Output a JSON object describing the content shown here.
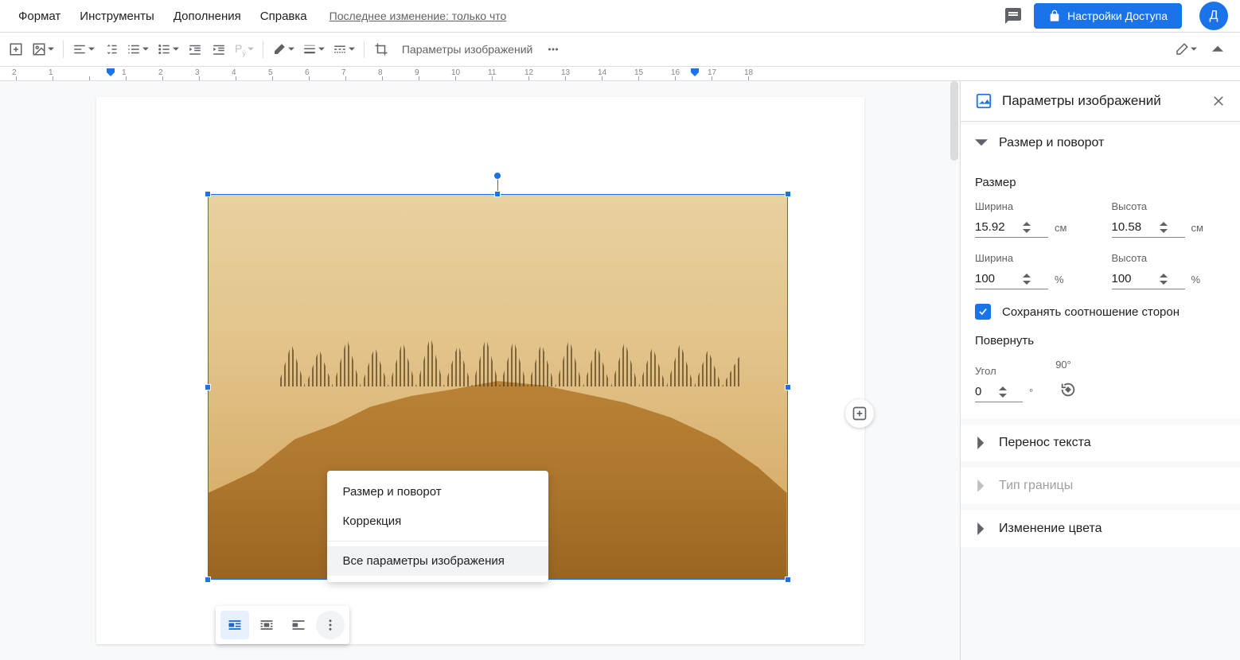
{
  "menubar": {
    "format": "Формат",
    "tools": "Инструменты",
    "addons": "Дополнения",
    "help": "Справка",
    "last_edit": "Последнее изменение: только что"
  },
  "header": {
    "share": "Настройки Доступа",
    "avatar": "Д"
  },
  "toolbar": {
    "image_options": "Параметры изображений"
  },
  "ruler": {
    "marks": [
      "2",
      "1",
      "",
      "1",
      "2",
      "3",
      "4",
      "5",
      "6",
      "7",
      "8",
      "9",
      "10",
      "11",
      "12",
      "13",
      "14",
      "15",
      "16",
      "17",
      "18"
    ]
  },
  "context_menu": {
    "size_rotate": "Размер и поворот",
    "correction": "Коррекция",
    "all_params": "Все параметры изображения"
  },
  "sidebar": {
    "title": "Параметры изображений",
    "size_rotate": {
      "header": "Размер и поворот",
      "size_lbl": "Размер",
      "width_lbl": "Ширина",
      "height_lbl": "Высота",
      "width_cm": "15.92",
      "height_cm": "10.58",
      "unit_cm": "см",
      "width_pct": "100",
      "height_pct": "100",
      "unit_pct": "%",
      "lock_ratio": "Сохранять соотношение сторон",
      "rotate_lbl": "Повернуть",
      "angle_lbl": "Угол",
      "angle_val": "0",
      "angle_unit": "°",
      "ninety": "90°"
    },
    "text_wrap": "Перенос текста",
    "border_type": "Тип границы",
    "recolor": "Изменение цвета"
  }
}
